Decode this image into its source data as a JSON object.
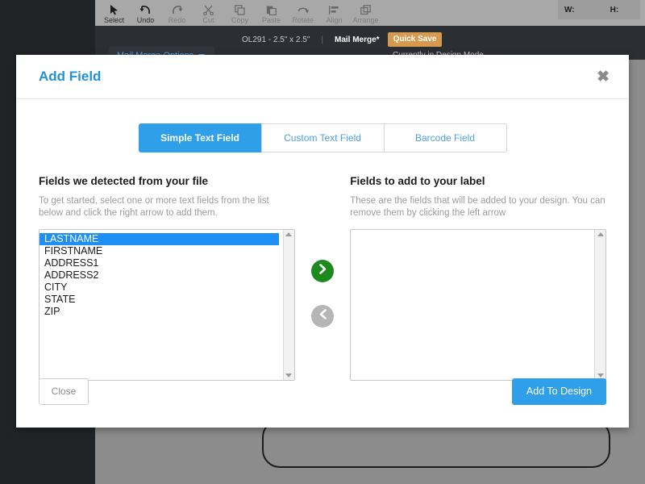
{
  "app": {
    "toolbar": {
      "tools": [
        {
          "label": "Select",
          "icon": "cursor-arrow-icon",
          "enabled": true
        },
        {
          "label": "Undo",
          "icon": "undo-arrow-icon",
          "enabled": true
        },
        {
          "label": "Redo",
          "icon": "redo-arrow-icon",
          "enabled": false
        },
        {
          "label": "Cut",
          "icon": "scissors-icon",
          "enabled": false
        },
        {
          "label": "Copy",
          "icon": "copy-icon",
          "enabled": false
        },
        {
          "label": "Paste",
          "icon": "paste-icon",
          "enabled": false
        },
        {
          "label": "Rotate",
          "icon": "rotate-icon",
          "enabled": false
        },
        {
          "label": "Align",
          "icon": "align-icon",
          "enabled": false
        },
        {
          "label": "Arrange",
          "icon": "arrange-icon",
          "enabled": false
        }
      ],
      "width_label": "W:",
      "height_label": "H:",
      "width_value": "",
      "height_value": ""
    },
    "subbar": {
      "template_spec": "OL291 - 2.5\" x 2.5\"",
      "mail_merge_label": "Mail Merge*",
      "quick_save_label": "Quick Save",
      "mail_merge_options_label": "Mail Merge Options",
      "design_mode_text": "Currently in Design Mode"
    },
    "colors": {
      "rail": "#212427",
      "canvas": "#8c8c8c",
      "toolbar": "#a8a8a8",
      "subbar": "#2b2e33",
      "quick_save": "#d59a4e",
      "link_blue": "#4da3e8"
    }
  },
  "modal": {
    "title": "Add Field",
    "close_icon_label": "✖",
    "tabs": [
      {
        "label": "Simple Text Field",
        "active": true
      },
      {
        "label": "Custom Text Field",
        "active": false
      },
      {
        "label": "Barcode Field",
        "active": false
      }
    ],
    "left_panel": {
      "heading": "Fields we detected from your file",
      "description": "To get started, select one or more text fields from the list below and click the right arrow to add them.",
      "items": [
        {
          "label": "LASTNAME",
          "selected": true
        },
        {
          "label": "FIRSTNAME",
          "selected": false
        },
        {
          "label": "ADDRESS1",
          "selected": false
        },
        {
          "label": "ADDRESS2",
          "selected": false
        },
        {
          "label": "CITY",
          "selected": false
        },
        {
          "label": "STATE",
          "selected": false
        },
        {
          "label": "ZIP",
          "selected": false
        }
      ]
    },
    "right_panel": {
      "heading": "Fields to add to your label",
      "description": "These are the fields that will be added to your design. You can remove them by clicking the left arrow",
      "items": []
    },
    "arrows": {
      "add_icon": "chevron-right-icon",
      "remove_icon": "chevron-left-icon"
    },
    "footer": {
      "close_label": "Close",
      "add_label": "Add To Design"
    },
    "colors": {
      "title_blue": "#1f90e0",
      "tab_active": "#2e9fe8",
      "selection_blue": "#1e90f5",
      "arrow_add_green": "#1e8a1e",
      "arrow_remove_gray": "#b5b5b5",
      "primary_button": "#2e9fe8"
    }
  }
}
